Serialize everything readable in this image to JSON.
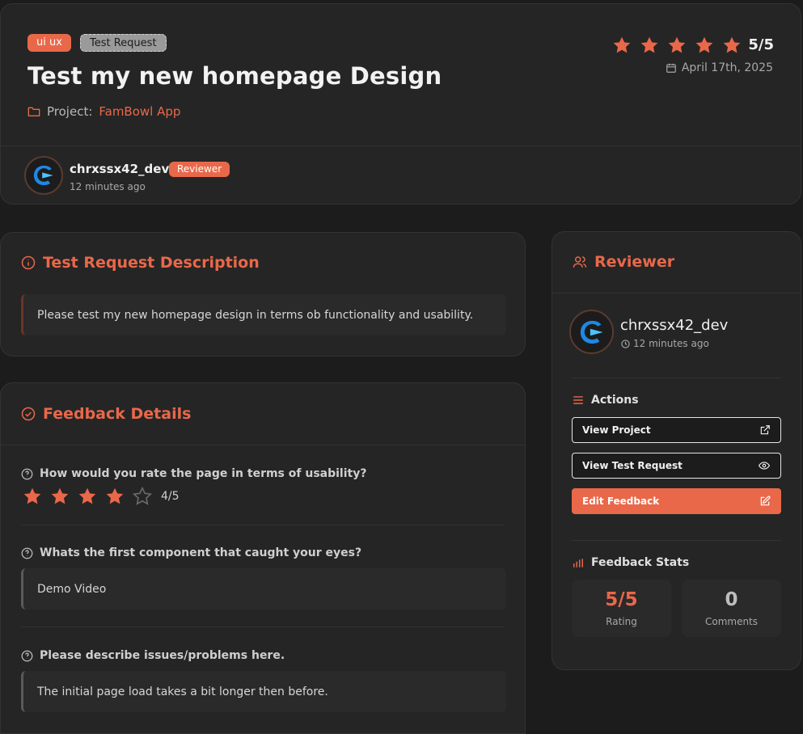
{
  "header": {
    "category_badge": "ui ux",
    "type_badge": "Test Request",
    "title": "Test my new homepage Design",
    "project_label": "Project:",
    "project_name": "FamBowl App",
    "rating": 5,
    "rating_text": "5/5",
    "date": "April 17th, 2025",
    "author": {
      "name": "chrxssx42_dev",
      "role_badge": "Reviewer",
      "time": "12 minutes ago"
    }
  },
  "description": {
    "title": "Test Request Description",
    "text": "Please test my new homepage design in terms ob functionality and usability."
  },
  "feedback": {
    "title": "Feedback Details",
    "questions": [
      {
        "label": "How would you rate the page in terms of usability?",
        "rating": 4,
        "max": 5,
        "rating_text": "4/5"
      },
      {
        "label": "Whats the first component that caught your eyes?",
        "answer": "Demo Video"
      },
      {
        "label": "Please describe issues/problems here.",
        "answer": "The initial page load takes a bit longer then before."
      }
    ]
  },
  "sidebar": {
    "title": "Reviewer",
    "reviewer": {
      "name": "chrxssx42_dev",
      "time": "12 minutes ago"
    },
    "actions_title": "Actions",
    "actions": [
      {
        "label": "View Project",
        "icon": "external-link-icon"
      },
      {
        "label": "View Test Request",
        "icon": "eye-icon"
      },
      {
        "label": "Edit Feedback",
        "icon": "edit-icon"
      }
    ],
    "stats_title": "Feedback Stats",
    "stats": [
      {
        "value": "5/5",
        "label": "Rating"
      },
      {
        "value": "0",
        "label": "Comments"
      }
    ]
  },
  "colors": {
    "accent": "#e9684a",
    "background": "#1c1c1c",
    "card": "#252525",
    "star_empty": "#6a6a6a"
  }
}
